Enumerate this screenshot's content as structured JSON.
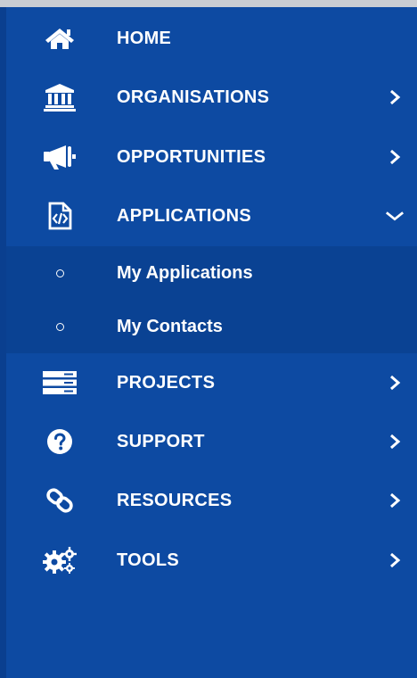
{
  "menu": {
    "home": {
      "label": "HOME",
      "icon": "home-icon"
    },
    "organisations": {
      "label": "ORGANISATIONS",
      "icon": "bank-icon"
    },
    "opportunities": {
      "label": "OPPORTUNITIES",
      "icon": "megaphone-icon"
    },
    "applications": {
      "label": "APPLICATIONS",
      "icon": "code-file-icon",
      "expanded": true,
      "children": [
        {
          "label": "My Applications"
        },
        {
          "label": "My Contacts"
        }
      ]
    },
    "projects": {
      "label": "PROJECTS",
      "icon": "server-icon"
    },
    "support": {
      "label": "SUPPORT",
      "icon": "question-circle-icon"
    },
    "resources": {
      "label": "RESOURCES",
      "icon": "link-icon"
    },
    "tools": {
      "label": "TOOLS",
      "icon": "gears-icon"
    }
  },
  "colors": {
    "sidebar_bg": "#0d4aa2",
    "submenu_bg": "#0a4293",
    "text": "#ffffff"
  }
}
